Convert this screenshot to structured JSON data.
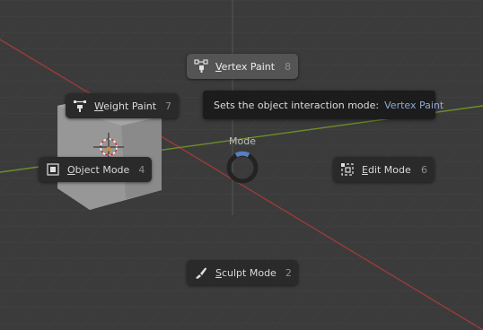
{
  "pie_menu": {
    "title": "Mode",
    "items": [
      {
        "name": "vertex-paint",
        "label_accel": "V",
        "label_rest": "ertex Paint",
        "key": "8",
        "active": true
      },
      {
        "name": "weight-paint",
        "label_accel": "W",
        "label_rest": "eight Paint",
        "key": "7",
        "active": false
      },
      {
        "name": "object-mode",
        "label_accel": "O",
        "label_rest": "bject Mode",
        "key": "4",
        "active": false
      },
      {
        "name": "edit-mode",
        "label_accel": "E",
        "label_rest": "dit Mode",
        "key": "6",
        "active": false
      },
      {
        "name": "sculpt-mode",
        "label_accel": "S",
        "label_rest": "culpt Mode",
        "key": "2",
        "active": false
      }
    ]
  },
  "tooltip": {
    "text": "Sets the object interaction mode:",
    "value": "Vertex Paint"
  },
  "colors": {
    "accent": "#5680c2",
    "x_axis": "#9a3b3b",
    "y_axis": "#6e8e2a",
    "selection_outline": "#e08a18"
  }
}
